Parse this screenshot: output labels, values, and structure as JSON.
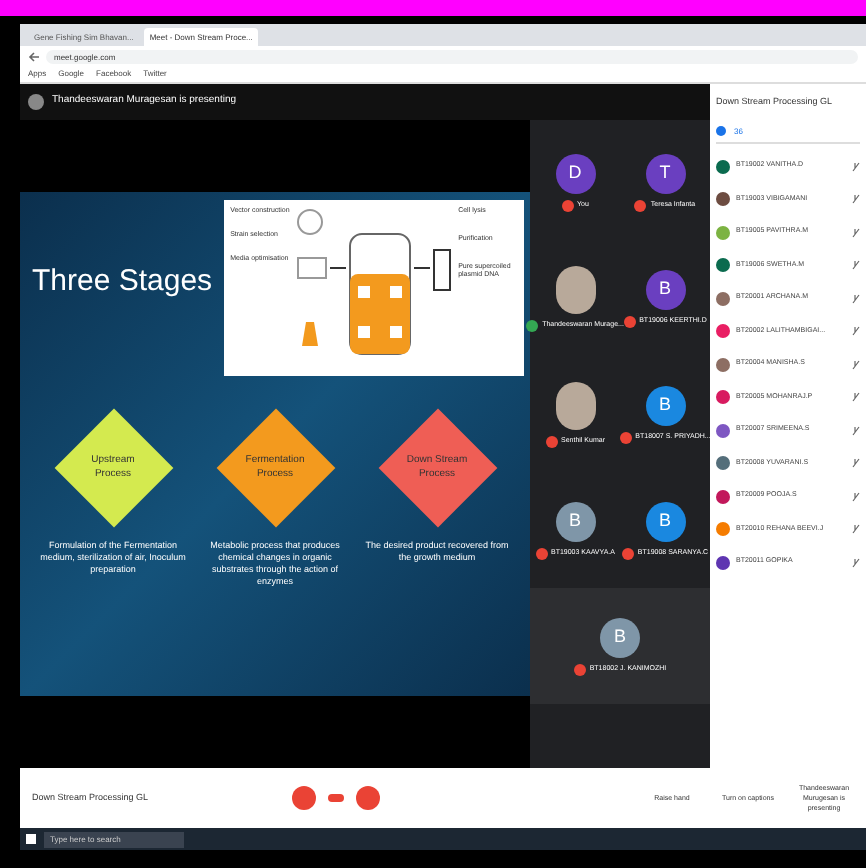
{
  "browser": {
    "tabs": [
      {
        "title": "Gene Fishing Sim Bhavan...",
        "selected": false
      },
      {
        "title": "Meet - Down Stream Proce...",
        "selected": true
      }
    ],
    "url": "meet.google.com",
    "bookmarks": [
      "Apps",
      "Google",
      "Facebook",
      "Twitter"
    ]
  },
  "presenting_banner": "Thandeeswaran Muragesan is presenting",
  "slide": {
    "title": "Three Stages",
    "diagram_labels": [
      "Vector construction",
      "Strain selection",
      "Media optimisation",
      "Cell lysis",
      "Purification",
      "Pure supercoiled plasmid DNA"
    ],
    "stages": [
      {
        "label": "Upstream Process",
        "color": "#d4ea4f",
        "description": "Formulation of the Fermentation medium, sterilization of air, Inoculum preparation"
      },
      {
        "label": "Fermentation Process",
        "color": "#f39a1e",
        "description": "Metabolic process that produces chemical changes in organic substrates through the action of enzymes"
      },
      {
        "label": "Down Stream Process",
        "color": "#ef5e55",
        "description": "The desired product recovered from the growth medium"
      }
    ]
  },
  "tiles": [
    {
      "name": "You",
      "kind": "initial",
      "initial": "D",
      "color": "#6a3fc0",
      "muted": true
    },
    {
      "name": "Teresa Infanta",
      "kind": "initial",
      "initial": "T",
      "color": "#6a3fc0",
      "muted": true
    },
    {
      "name": "Thandeeswaran Murage...",
      "kind": "photo",
      "muted": false
    },
    {
      "name": "BT19006 KEERTHI.D",
      "kind": "initial",
      "initial": "B",
      "color": "#6a3fc0",
      "muted": true
    },
    {
      "name": "Senthil Kumar",
      "kind": "photo",
      "muted": true
    },
    {
      "name": "BT18007 S. PRIYADH...",
      "kind": "initial",
      "initial": "B",
      "color": "#1a88e0",
      "muted": true
    },
    {
      "name": "BT19003 KAAVYA.A",
      "kind": "initial",
      "initial": "B",
      "color": "#7f96a8",
      "muted": true
    },
    {
      "name": "BT19008 SARANYA.C",
      "kind": "initial",
      "initial": "B",
      "color": "#1a88e0",
      "muted": true
    },
    {
      "name": "BT18002 J. KANIMOZHI",
      "kind": "initial",
      "initial": "B",
      "color": "#7f96a8",
      "muted": true
    }
  ],
  "people_panel": {
    "title": "Down Stream Processing GL",
    "count": "36",
    "people": [
      {
        "name": "BT19002 VANITHA.D",
        "color": "#0b6b4f"
      },
      {
        "name": "BT19003 VIBIGAMANI",
        "color": "#6d4c41"
      },
      {
        "name": "BT19005 PAVITHRA.M",
        "color": "#7cb342"
      },
      {
        "name": "BT19006 SWETHA.M",
        "color": "#0b6b4f"
      },
      {
        "name": "BT20001 ARCHANA.M",
        "color": "#8d6e63"
      },
      {
        "name": "BT20002 LALITHAMBIGAI...",
        "color": "#e91e63"
      },
      {
        "name": "BT20004 MANISHA.S",
        "color": "#8d6e63"
      },
      {
        "name": "BT20005 MOHANRAJ.P",
        "color": "#d81b60"
      },
      {
        "name": "BT20007 SRIMEENA.S",
        "color": "#7e57c2"
      },
      {
        "name": "BT20008 YUVARANI.S",
        "color": "#546e7a"
      },
      {
        "name": "BT20009 POOJA.S",
        "color": "#c2185b"
      },
      {
        "name": "BT20010 REHANA BEEVI.J",
        "color": "#f57c00"
      },
      {
        "name": "BT20011 GOPIKA",
        "color": "#5e35b1"
      }
    ]
  },
  "bottom_bar": {
    "meeting": "Down Stream Processing GL",
    "actions": [
      "Raise hand",
      "Turn on captions",
      "Thandeeswaran Murugesan is presenting"
    ]
  },
  "taskbar": {
    "search": "Type here to search"
  }
}
